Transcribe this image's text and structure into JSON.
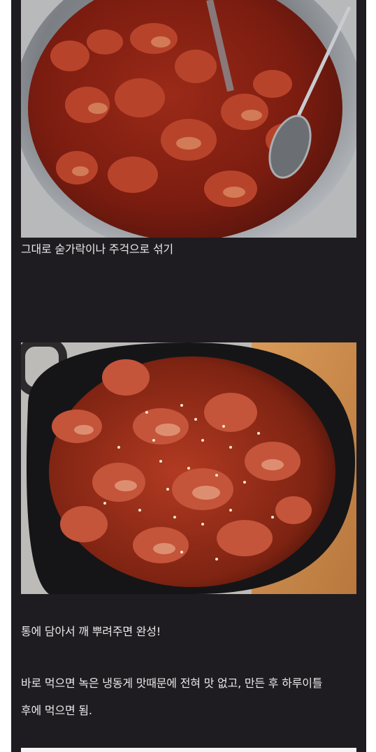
{
  "post": {
    "images": [
      {
        "name": "crab-mixing-bowl-photo"
      },
      {
        "name": "crab-finished-container-photo"
      }
    ],
    "captions": [
      "그대로 숟가락이나 주걱으로 섞기",
      "통에 담아서 깨 뿌려주면 완성!",
      "바로 먹으면 녹은 냉동게 맛때문에 전혀 맛 없고, 만든 후 하루이틀",
      "후에 먹으면 됨."
    ]
  }
}
